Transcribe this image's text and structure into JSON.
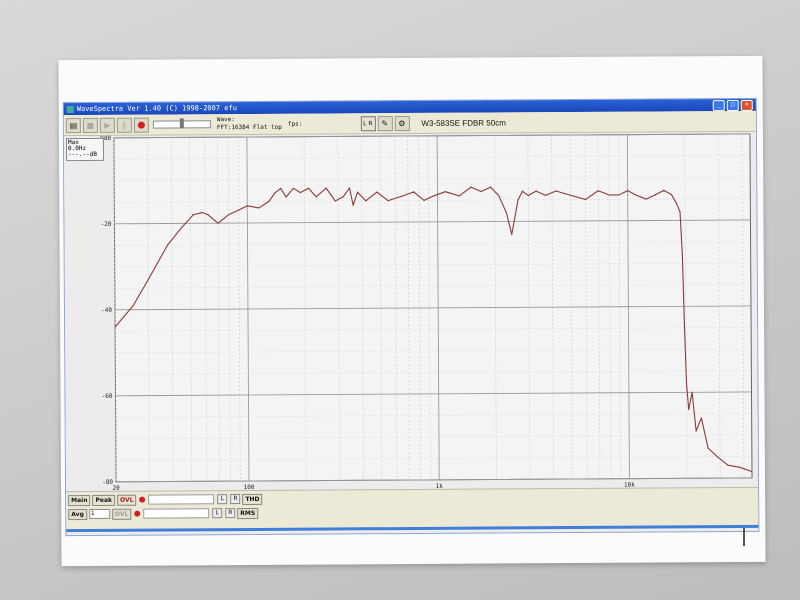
{
  "window": {
    "title": "WaveSpectra Ver 1.40 (C) 1998-2007 efu",
    "minimize_glyph": "_",
    "maximize_glyph": "□",
    "close_glyph": "×"
  },
  "toolbar": {
    "wave_label": "Wave:",
    "fft_label": "FFT:16384 Flat top",
    "fps_label": "fps:",
    "lr_label": "L R",
    "document_title": "W3-583SE FDBR 50cm"
  },
  "max_box": {
    "title": "Max",
    "freq": "0.0Hz",
    "level": "---.--dB"
  },
  "chart_data": {
    "type": "line",
    "x_scale": "log",
    "xlim": [
      20,
      44100
    ],
    "ylim": [
      -80,
      0
    ],
    "y_ticks": [
      0,
      -20,
      -40,
      -60,
      -80
    ],
    "y_tick_labels": [
      "0dB",
      "-20",
      "-40",
      "-60",
      "-80"
    ],
    "x_ticks": [
      20,
      100,
      1000,
      10000
    ],
    "x_tick_labels": [
      "20",
      "100",
      "1k",
      "10k"
    ],
    "grid": true,
    "series": [
      {
        "color": "#8a3a3a",
        "x": [
          20,
          25,
          30,
          38,
          45,
          52,
          58,
          62,
          70,
          80,
          90,
          100,
          115,
          130,
          140,
          150,
          160,
          175,
          190,
          210,
          230,
          260,
          290,
          320,
          345,
          360,
          380,
          420,
          480,
          550,
          650,
          750,
          850,
          950,
          1100,
          1300,
          1500,
          1700,
          1900,
          2100,
          2300,
          2450,
          2550,
          2650,
          2800,
          3000,
          3300,
          3700,
          4200,
          5000,
          6000,
          7000,
          8000,
          9000,
          10000,
          11000,
          12500,
          14000,
          15500,
          17000,
          18000,
          18800,
          19300,
          19700,
          20100,
          20600,
          21500,
          22500,
          24000,
          26000,
          29000,
          33000,
          38000,
          44000
        ],
        "y": [
          -44,
          -39,
          -33,
          -25,
          -21,
          -18,
          -17.5,
          -18,
          -20,
          -18,
          -17,
          -16,
          -16.5,
          -15,
          -13,
          -12,
          -14,
          -12,
          -13,
          -12,
          -14,
          -12,
          -15,
          -14,
          -12,
          -16,
          -13,
          -15,
          -13,
          -15,
          -14,
          -13,
          -15,
          -14,
          -13,
          -14,
          -12,
          -13,
          -12,
          -14,
          -18,
          -23,
          -19,
          -15,
          -13,
          -14,
          -13,
          -14,
          -13,
          -14,
          -15,
          -13,
          -14,
          -14,
          -13,
          -14,
          -15,
          -14,
          -13,
          -14,
          -16,
          -18,
          -28,
          -45,
          -58,
          -64,
          -60,
          -69,
          -66,
          -73,
          -75,
          -77,
          -77.5,
          -78.5
        ]
      }
    ]
  },
  "bottom_bar": {
    "main_label": "Main",
    "peak_label": "Peak",
    "ovl_label": "OVL",
    "l_label": "L",
    "r_label": "R",
    "thd_label": "THD",
    "avg_label": "Avg",
    "avg_value": "1",
    "rms_label": "RMS"
  }
}
